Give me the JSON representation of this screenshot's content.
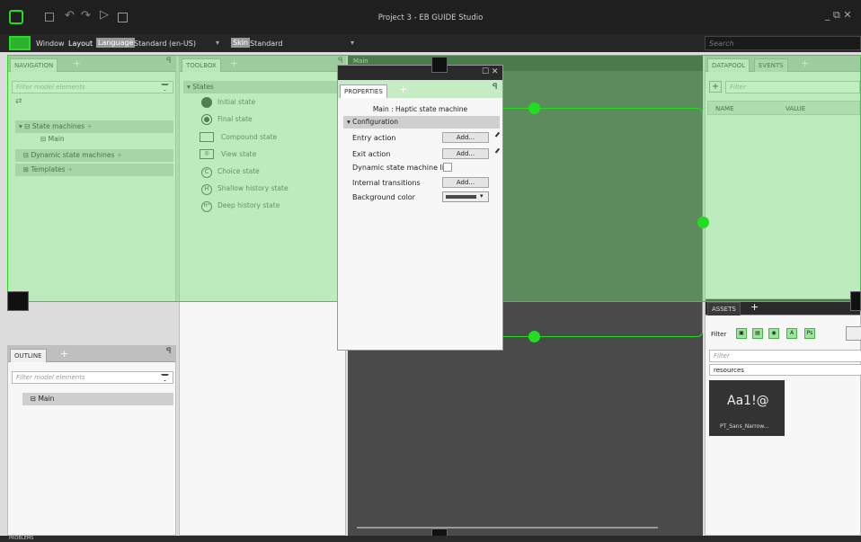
{
  "title": "Project 3 - EB GUIDE Studio",
  "toolbar": {
    "window": "Window",
    "layout": "Layout",
    "language_label": "Language",
    "language_value": "Standard (en-US)",
    "skin_label": "Skin",
    "skin_value": "Standard",
    "search_placeholder": "Search"
  },
  "navigation": {
    "tab": "NAVIGATION",
    "filter_placeholder": "Filter model elements",
    "items": [
      "State machines",
      "Main",
      "Dynamic state machines",
      "Templates"
    ]
  },
  "outline": {
    "tab": "OUTLINE",
    "filter_placeholder": "Filter model elements",
    "items": [
      "Main"
    ]
  },
  "toolbox": {
    "tab": "TOOLBOX",
    "section": "States",
    "items": [
      "Initial state",
      "Final state",
      "Compound state",
      "View state",
      "Choice state",
      "Shallow history state",
      "Deep history state"
    ]
  },
  "properties": {
    "tab": "PROPERTIES",
    "subtitle": "Main : Haptic state machine",
    "section": "Configuration",
    "rows": [
      {
        "label": "Entry action",
        "button": "Add..."
      },
      {
        "label": "Exit action",
        "button": "Add..."
      },
      {
        "label": "Dynamic state machine list"
      },
      {
        "label": "Internal transitions",
        "button": "Add..."
      },
      {
        "label": "Background color"
      }
    ]
  },
  "main_tab": "Main",
  "datapool": {
    "tabs": [
      "DATAPOOL",
      "EVENTS"
    ],
    "filter_placeholder": "Filter",
    "columns": [
      "NAME",
      "VALUE"
    ]
  },
  "assets": {
    "tab": "ASSETS",
    "filter_label": "Filter",
    "filter_icons": [
      "A",
      "Ps"
    ],
    "search_placeholder": "Filter",
    "folder": "resources",
    "item_preview": "Aa1!@",
    "item_name": "PT_Sans_Narrow..."
  },
  "bottom_tab": "PROBLEMS",
  "colors": {
    "accent": "#22dd22",
    "overlay": "#78dc78"
  }
}
